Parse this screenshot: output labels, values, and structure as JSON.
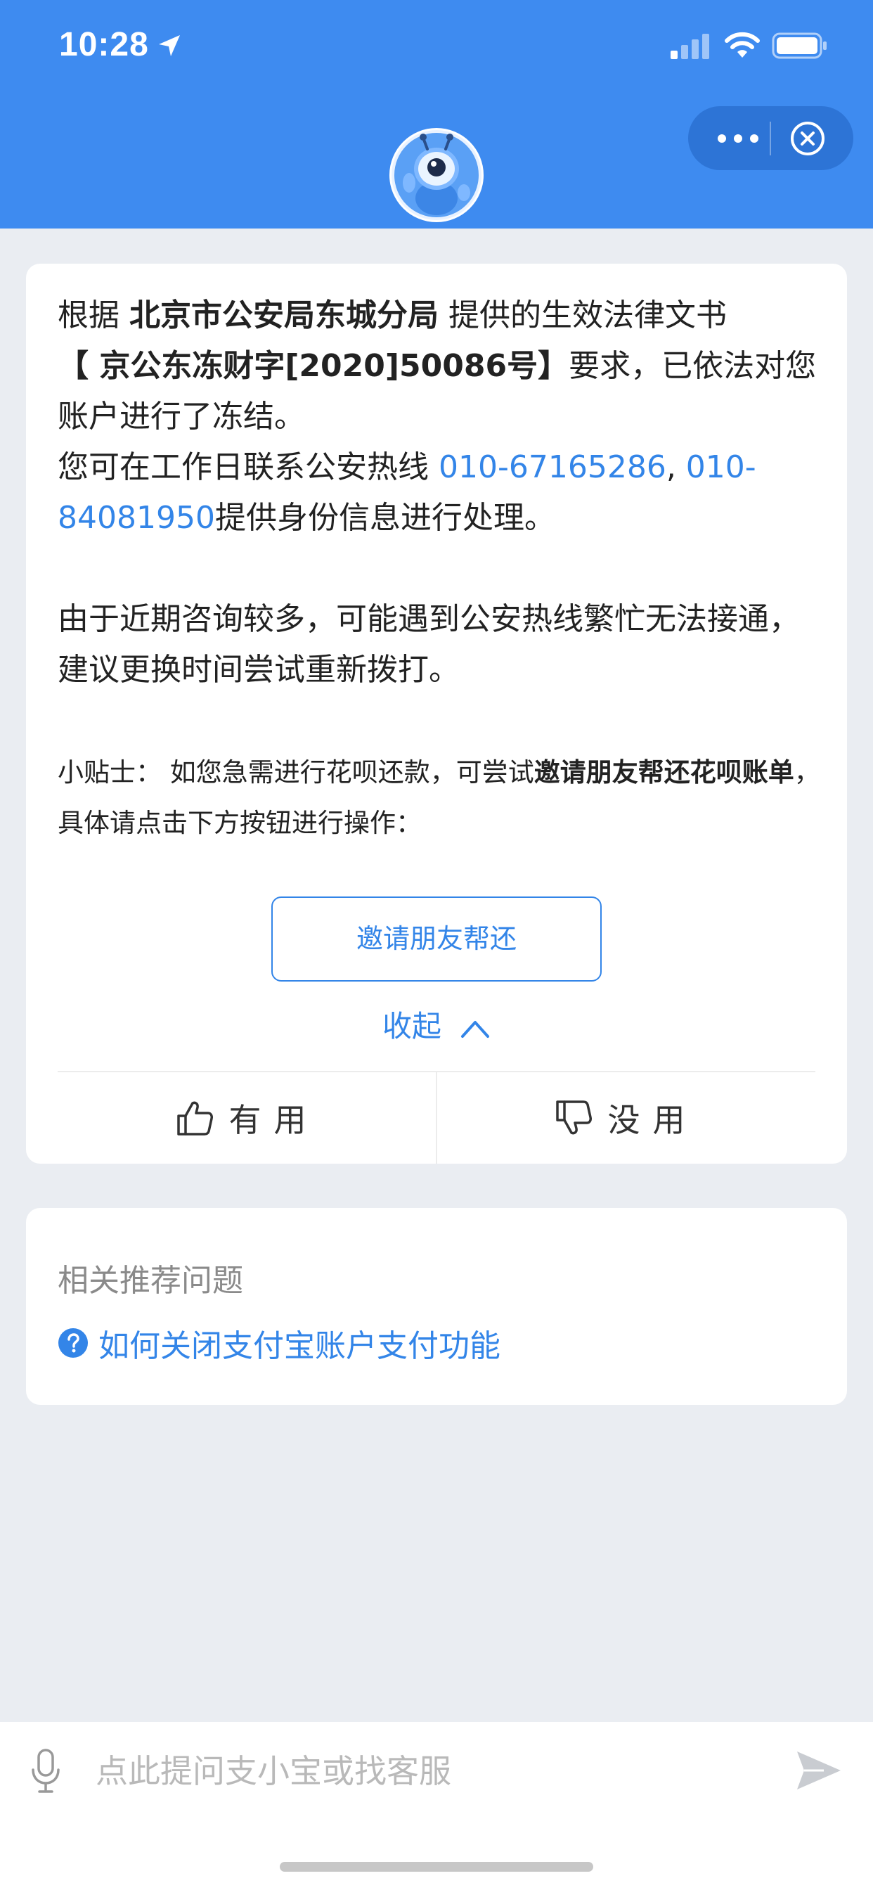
{
  "status_bar": {
    "time": "10:28"
  },
  "header": {
    "avatar_alt": "robot-avatar"
  },
  "message": {
    "part1": "根据 ",
    "org": "北京市公安局东城分局",
    "part2": " 提供的生效法律文书",
    "doc_no": "【 京公东冻财字[2020]50086号】",
    "part3": "要求，已依法对您账户进行了冻结。",
    "hotline_text": "您可在工作日联系公安热线 ",
    "phone1": "010-67165286",
    "sep": ", ",
    "phone2": "010-84081950",
    "hotline_tail": "提供身份信息进行处理。",
    "para2": "由于近期咨询较多，可能遇到公安热线繁忙无法接通，建议更换时间尝试重新拨打。"
  },
  "tip": {
    "prefix": "小贴士：  如您急需进行花呗还款，可尝试",
    "bold": "邀请朋友帮还花呗账单",
    "suffix": "，具体请点击下方按钮进行操作："
  },
  "invite_button": "邀请朋友帮还",
  "collapse_label": "收起",
  "vote": {
    "useful": "有用",
    "useless": "没用"
  },
  "related": {
    "title": "相关推荐问题",
    "items": [
      "如何关闭支付宝账户支付功能"
    ]
  },
  "input": {
    "placeholder": "点此提问支小宝或找客服"
  },
  "colors": {
    "header_blue": "#3e8bf0",
    "link_blue": "#3385e8",
    "background": "#eaedf2"
  }
}
